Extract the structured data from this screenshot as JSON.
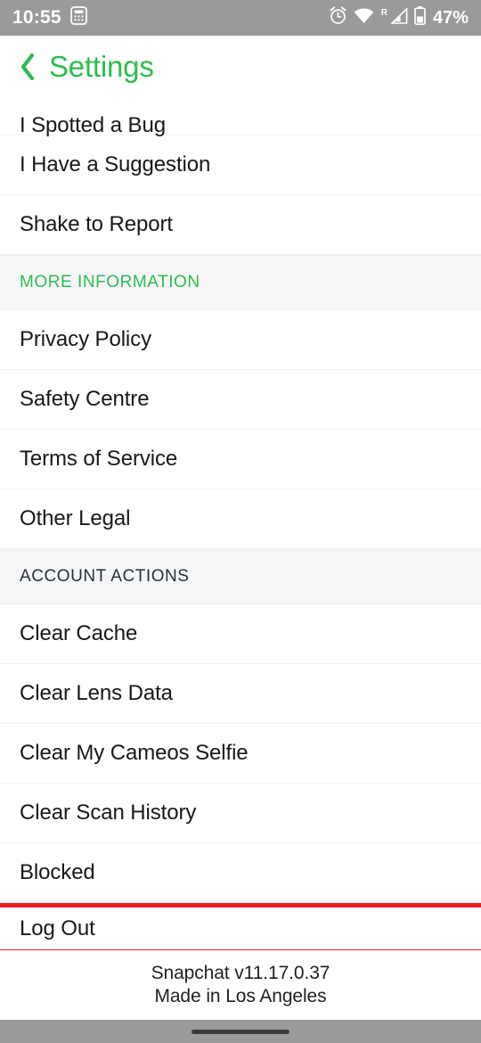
{
  "status_bar": {
    "time": "10:55",
    "left_icons": [
      {
        "name": "calculator-icon",
        "glyph": "calculator"
      }
    ],
    "right_icons": [
      {
        "name": "alarm-clock-icon",
        "glyph": "alarm"
      },
      {
        "name": "wifi-icon",
        "glyph": "wifi"
      },
      {
        "name": "cellular-signal-icon",
        "glyph": "signal",
        "badge": "R"
      },
      {
        "name": "battery-icon",
        "glyph": "battery"
      }
    ],
    "battery_percent": "47%",
    "background_color": "#9a9a9a",
    "foreground_color": "#ffffff"
  },
  "header": {
    "back_label": "‹",
    "title": "Settings",
    "accent_color": "#2fbb4f"
  },
  "list": [
    {
      "type": "item",
      "name": "i-spotted-a-bug",
      "label": "I Spotted a Bug",
      "clipped": true
    },
    {
      "type": "item",
      "name": "i-have-a-suggestion",
      "label": "I Have a Suggestion"
    },
    {
      "type": "item",
      "name": "shake-to-report",
      "label": "Shake to Report"
    },
    {
      "type": "header",
      "name": "more-information",
      "label": "MORE INFORMATION",
      "style": "green"
    },
    {
      "type": "item",
      "name": "privacy-policy",
      "label": "Privacy Policy"
    },
    {
      "type": "item",
      "name": "safety-centre",
      "label": "Safety Centre"
    },
    {
      "type": "item",
      "name": "terms-of-service",
      "label": "Terms of Service"
    },
    {
      "type": "item",
      "name": "other-legal",
      "label": "Other Legal"
    },
    {
      "type": "header",
      "name": "account-actions",
      "label": "ACCOUNT ACTIONS",
      "style": "dark"
    },
    {
      "type": "item",
      "name": "clear-cache",
      "label": "Clear Cache"
    },
    {
      "type": "item",
      "name": "clear-lens-data",
      "label": "Clear Lens Data"
    },
    {
      "type": "item",
      "name": "clear-my-cameos-selfie",
      "label": "Clear My Cameos Selfie"
    },
    {
      "type": "item",
      "name": "clear-scan-history",
      "label": "Clear Scan History"
    },
    {
      "type": "item",
      "name": "blocked",
      "label": "Blocked"
    },
    {
      "type": "item",
      "name": "log-out",
      "label": "Log Out",
      "highlighted": true
    }
  ],
  "highlight": {
    "color": "#ee1c25",
    "target": "Log Out"
  },
  "footer": {
    "version_line": "Snapchat v11.17.0.37",
    "made_in_line": "Made in Los Angeles"
  },
  "nav_bar": {
    "gesture_pill": "home-gesture-pill",
    "background_color": "#9a9a9a"
  }
}
